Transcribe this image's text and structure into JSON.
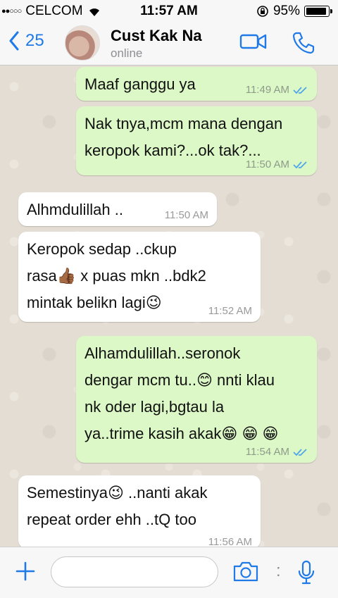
{
  "status_bar": {
    "signal_dots": "●●○○○",
    "carrier": "CELCOM",
    "wifi_icon": "wifi-icon",
    "time": "11:57 AM",
    "lock_icon": "rotation-lock-icon",
    "battery_percent": "95%"
  },
  "header": {
    "back_count": "25",
    "contact_name": "Cust Kak Na",
    "contact_status": "online",
    "accent_color": "#1f7ae8"
  },
  "messages": [
    {
      "direction": "out",
      "text": "Maaf ganggu ya",
      "time": "11:49 AM",
      "read": true
    },
    {
      "direction": "out",
      "text": "Nak tnya,mcm mana dengan\nkeropok kami?...ok tak?...",
      "time": "11:50 AM",
      "read": true
    },
    {
      "direction": "in",
      "text": "Alhmdulillah ..",
      "time": "11:50 AM"
    },
    {
      "direction": "in",
      "text": "Keropok sedap ..ckup\nrasa👍🏾 x puas mkn ..bdk2\nmintak belikn lagi😉",
      "time": "11:52 AM"
    },
    {
      "direction": "out",
      "text": "Alhamdulillah..seronok\ndengar mcm tu..😊 nnti klau\nnk oder lagi,bgtau la\nya..trime kasih akak😁 😁 😁",
      "time": "11:54 AM",
      "read": true
    },
    {
      "direction": "in",
      "text": "Semestinya😉 ..nanti akak\nrepeat order ehh ..tQ too",
      "time": "11:56 AM"
    }
  ],
  "colors": {
    "outgoing_bubble": "#dcf8c6",
    "incoming_bubble": "#ffffff",
    "chat_background": "#e4ddd3",
    "read_ticks": "#4fa6e8"
  },
  "input_bar": {
    "plus_icon": "plus-icon",
    "camera_icon": "camera-icon",
    "mic_icon": "microphone-icon",
    "separator": ":"
  }
}
